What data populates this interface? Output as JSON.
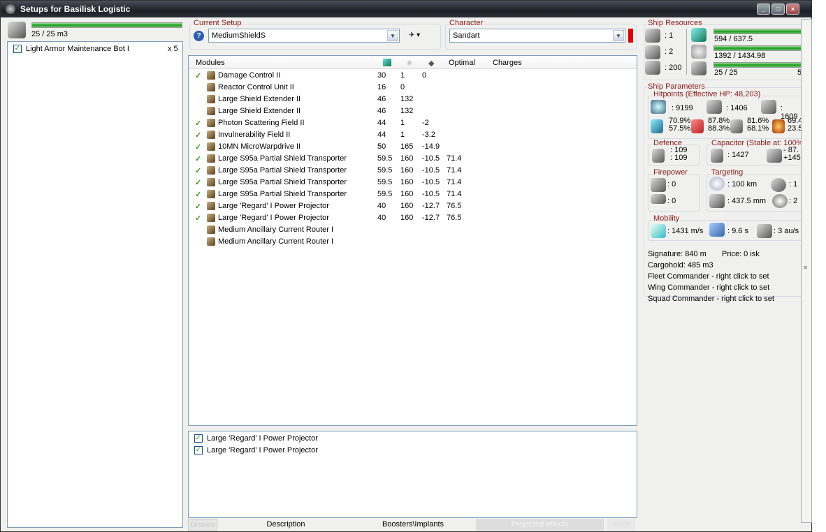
{
  "window": {
    "title": "Setups for Basilisk Logistic",
    "controls": [
      "_",
      "□",
      "×"
    ]
  },
  "drones": {
    "bay_fill": 1.0,
    "bay_text": "25 / 25 m3",
    "items": [
      {
        "name": "Light Armor Maintenance Bot I",
        "qty": "x 5",
        "checked": true
      }
    ]
  },
  "setup": {
    "label": "Current Setup",
    "value": "MediumShieldS",
    "help_icon": "question-icon",
    "ship_menu_icon": "ship-icon"
  },
  "character": {
    "label": "Character",
    "value": "Sandart",
    "status_color": "#e00000"
  },
  "modules": {
    "headers": [
      "Modules",
      "cpu-icon",
      "powergrid-icon",
      "capacitor-icon",
      "Optimal",
      "Charges"
    ],
    "rows": [
      {
        "active": true,
        "name": "Damage Control II",
        "cpu": "30",
        "pg": "1",
        "cap": "0",
        "optimal": ""
      },
      {
        "active": false,
        "name": "Reactor Control Unit II",
        "cpu": "16",
        "pg": "0",
        "cap": "",
        "optimal": ""
      },
      {
        "active": false,
        "name": "Large Shield Extender II",
        "cpu": "46",
        "pg": "132",
        "cap": "",
        "optimal": ""
      },
      {
        "active": false,
        "name": "Large Shield Extender II",
        "cpu": "46",
        "pg": "132",
        "cap": "",
        "optimal": ""
      },
      {
        "active": true,
        "name": "Photon Scattering Field II",
        "cpu": "44",
        "pg": "1",
        "cap": "-2",
        "optimal": ""
      },
      {
        "active": true,
        "name": "Invulnerability Field II",
        "cpu": "44",
        "pg": "1",
        "cap": "-3.2",
        "optimal": ""
      },
      {
        "active": true,
        "name": "10MN MicroWarpdrive II",
        "cpu": "50",
        "pg": "165",
        "cap": "-14.9",
        "optimal": ""
      },
      {
        "active": true,
        "name": "Large S95a Partial Shield Transporter",
        "cpu": "59.5",
        "pg": "160",
        "cap": "-10.5",
        "optimal": "71.4"
      },
      {
        "active": true,
        "name": "Large S95a Partial Shield Transporter",
        "cpu": "59.5",
        "pg": "160",
        "cap": "-10.5",
        "optimal": "71.4"
      },
      {
        "active": true,
        "name": "Large S95a Partial Shield Transporter",
        "cpu": "59.5",
        "pg": "160",
        "cap": "-10.5",
        "optimal": "71.4"
      },
      {
        "active": true,
        "name": "Large S95a Partial Shield Transporter",
        "cpu": "59.5",
        "pg": "160",
        "cap": "-10.5",
        "optimal": "71.4"
      },
      {
        "active": true,
        "name": "Large 'Regard' I Power Projector",
        "cpu": "40",
        "pg": "160",
        "cap": "-12.7",
        "optimal": "76.5"
      },
      {
        "active": true,
        "name": "Large 'Regard' I Power Projector",
        "cpu": "40",
        "pg": "160",
        "cap": "-12.7",
        "optimal": "76.5"
      },
      {
        "active": false,
        "name": "Medium Ancillary Current Router I",
        "cpu": "",
        "pg": "",
        "cap": "",
        "optimal": ""
      },
      {
        "active": false,
        "name": "Medium Ancillary Current Router I",
        "cpu": "",
        "pg": "",
        "cap": "",
        "optimal": ""
      }
    ]
  },
  "projected": [
    {
      "name": "Large 'Regard' I Power Projector",
      "checked": true
    },
    {
      "name": "Large 'Regard' I Power Projector",
      "checked": true
    }
  ],
  "tabs": [
    "Drones",
    "Description",
    "Boosters\\Implants",
    "Projected effects",
    "Stats"
  ],
  "resources": {
    "label": "Ship Resources",
    "turrets": ": 1",
    "launchers": ": 2",
    "calibration": ": 200",
    "cpu": {
      "text": "594 / 637.5",
      "fill": 0.93
    },
    "powergrid": {
      "text": "1392 / 1434.98",
      "fill": 0.97
    },
    "drone_bandwidth": {
      "text": "25 / 25",
      "fill": 1.0,
      "extra": "5"
    }
  },
  "params": {
    "label": "Ship Parameters",
    "hp_label": "Hitpoints (Effective HP: 48,203)",
    "shield": ": 9199",
    "armor": ": 1406",
    "structure": ": 1609",
    "resists": [
      [
        "70.9%",
        "57.5%"
      ],
      [
        "87.8%",
        "88.3%"
      ],
      [
        "81.6%",
        "68.1%"
      ],
      [
        "69.4%",
        "23.5%"
      ]
    ],
    "defence_label": "Defence",
    "defence": [
      ": 109",
      ": 109"
    ],
    "cap_label": "Capacitor (Stable at: 100%)",
    "cap_amount": ": 1427",
    "cap_delta": [
      "- 87.",
      "+145"
    ],
    "firepower_label": "Firepower",
    "turret_dps": ": 0",
    "missile_dps": ": 0",
    "targeting_label": "Targeting",
    "range": ": 100 km",
    "scan_res": ": 437.5 mm",
    "max_targets": ": 1",
    "sensor": ": 2",
    "mobility_label": "Mobility",
    "speed": ": 1431 m/s",
    "align": ": 9.6 s",
    "warp": ": 3 au/s"
  },
  "info": [
    "Signature: 840 m",
    "Price: 0 isk",
    "Cargohold: 485 m3",
    "Fleet Commander - right click to set",
    "Wing Commander - right click to set",
    "Squad Commander - right click to set"
  ]
}
